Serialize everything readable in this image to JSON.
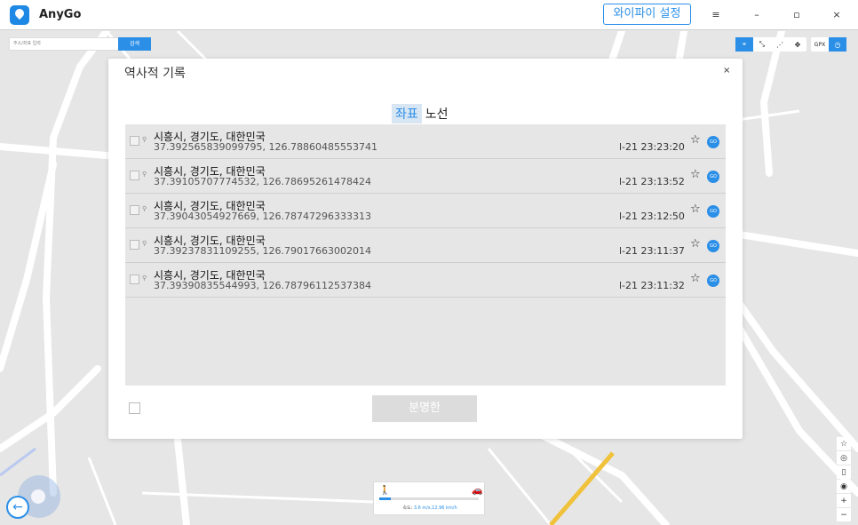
{
  "app": {
    "name": "AnyGo",
    "wifi_button": "와이파이 설정"
  },
  "window_controls": {
    "menu": "≡",
    "minimize": "–",
    "maximize": "▫",
    "close": "×"
  },
  "search": {
    "placeholder": "주소/좌표 입력",
    "button": "검색"
  },
  "toolbar": {
    "gpx": "GPX"
  },
  "speed": {
    "label": "속도:",
    "value": "3.6 m/s,12.96 km/h",
    "fraction": 0.12
  },
  "dialog": {
    "title": "역사적 기록",
    "close": "×",
    "tabs": [
      {
        "label": "좌표",
        "active": true
      },
      {
        "label": "노선",
        "active": false
      }
    ],
    "rows": [
      {
        "place": "시흥시, 경기도, 대한민국",
        "coords": "37.392565839099795, 126.78860485553741",
        "time": "l-21 23:23:20",
        "go": "GO"
      },
      {
        "place": "시흥시, 경기도, 대한민국",
        "coords": "37.39105707774532, 126.78695261478424",
        "time": "l-21 23:13:52",
        "go": "GO"
      },
      {
        "place": "시흥시, 경기도, 대한민국",
        "coords": "37.39043054927669, 126.78747296333313",
        "time": "l-21 23:12:50",
        "go": "GO"
      },
      {
        "place": "시흥시, 경기도, 대한민국",
        "coords": "37.39237831109255, 126.79017663002014",
        "time": "l-21 23:11:37",
        "go": "GO"
      },
      {
        "place": "시흥시, 경기도, 대한민국",
        "coords": "37.39390835544993, 126.78796112537384",
        "time": "l-21 23:11:32",
        "go": "GO"
      }
    ],
    "clear_button": "분명한"
  },
  "colors": {
    "accent": "#2b8fe8"
  }
}
